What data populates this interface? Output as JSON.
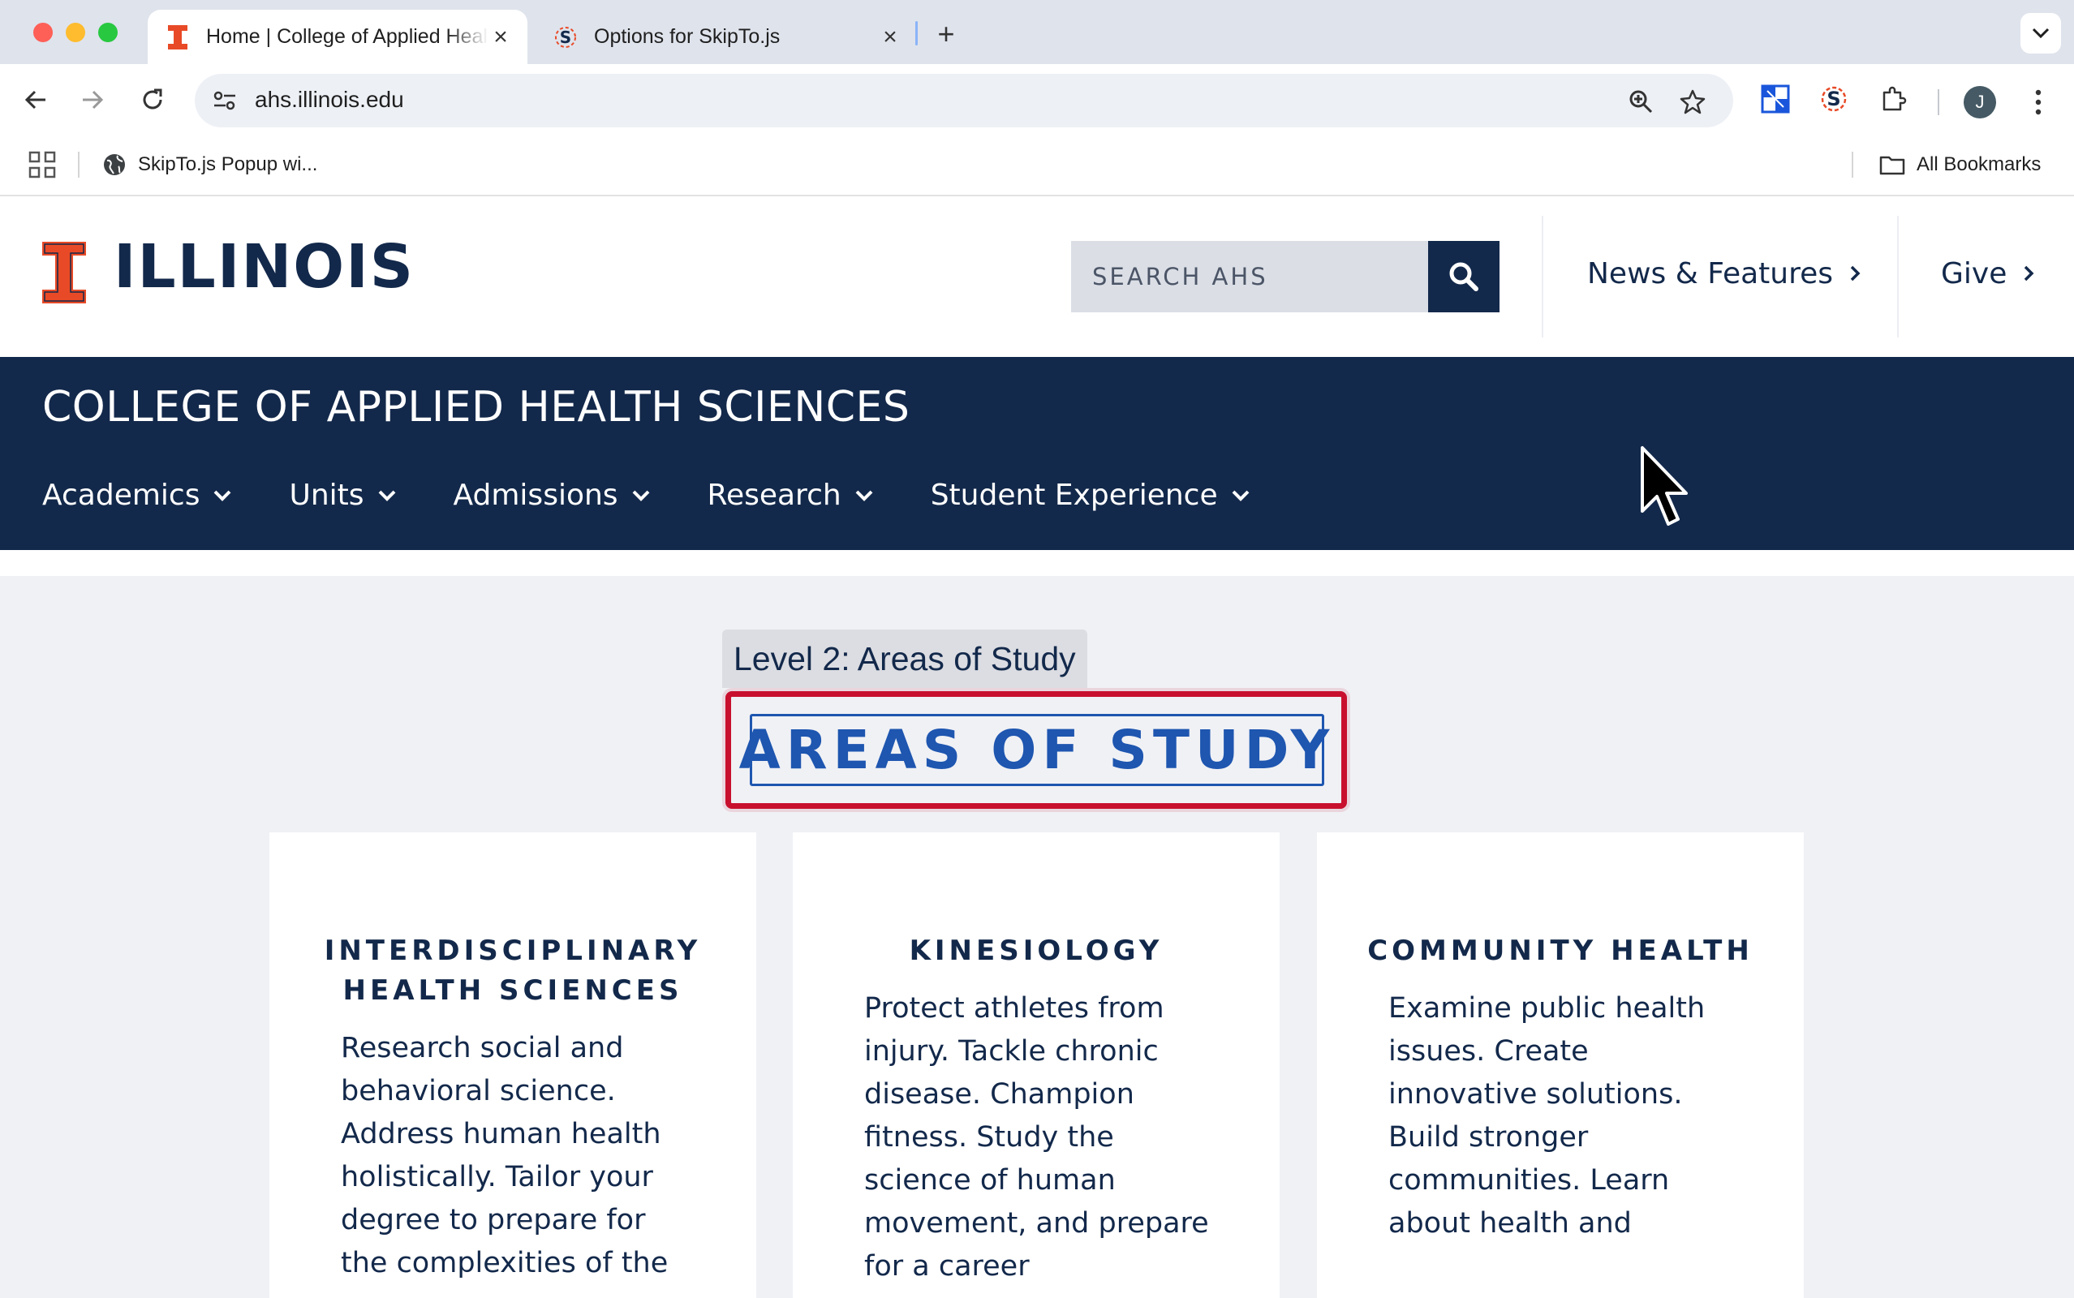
{
  "browser": {
    "tabs": [
      {
        "title": "Home | College of Applied Health Sciences",
        "active": true
      },
      {
        "title": "Options for SkipTo.js",
        "active": false
      }
    ],
    "url": "ahs.illinois.edu",
    "avatar_initial": "J",
    "bookmarks": {
      "items": [
        {
          "label": "SkipTo.js Popup wi..."
        }
      ],
      "all_label": "All Bookmarks"
    }
  },
  "site": {
    "logo_text": "ILLINOIS",
    "search_placeholder": "SEARCH AHS",
    "header_links": [
      {
        "label": "News & Features"
      },
      {
        "label": "Give"
      }
    ],
    "college_title": "COLLEGE OF APPLIED HEALTH SCIENCES",
    "nav": [
      {
        "label": "Academics"
      },
      {
        "label": "Units"
      },
      {
        "label": "Admissions"
      },
      {
        "label": "Research"
      },
      {
        "label": "Student Experience"
      }
    ],
    "colors": {
      "navy": "#13294b",
      "orange": "#e84a27",
      "heading_blue": "#1e56b0",
      "highlight_red": "#c8102e"
    }
  },
  "skipto": {
    "label": "Level 2: Areas of Study"
  },
  "main": {
    "heading": "AREAS OF STUDY",
    "cards": [
      {
        "title": "INTERDISCIPLINARY HEALTH SCIENCES",
        "text": "Research social and behavioral science. Address human health holistically. Tailor your degree to prepare for the complexities of the"
      },
      {
        "title": "KINESIOLOGY",
        "text": "Protect athletes from injury. Tackle chronic disease. Champion fitness. Study the science of human movement, and prepare for a career"
      },
      {
        "title": "COMMUNITY HEALTH",
        "text": "Examine public health issues. Create innovative solutions. Build stronger communities. Learn about health and"
      }
    ]
  }
}
